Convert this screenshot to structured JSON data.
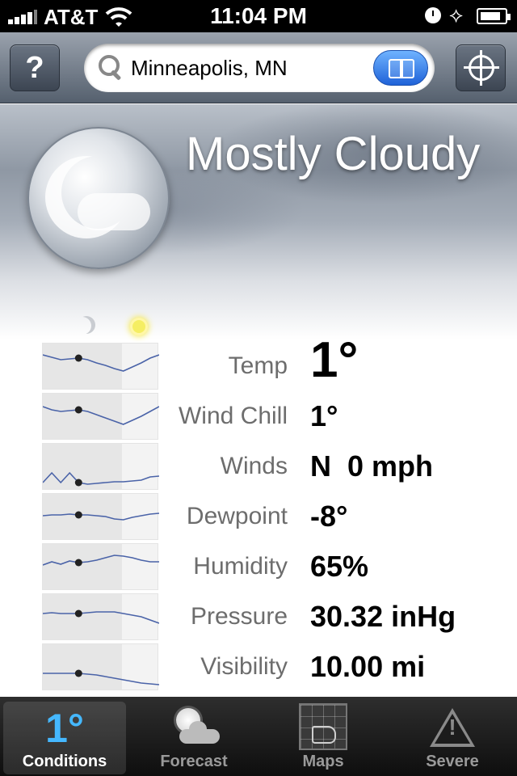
{
  "status_bar": {
    "carrier": "AT&T",
    "time": "11:04 PM",
    "bluetooth_glyph": "⟡"
  },
  "nav": {
    "help_label": "?",
    "search_value": "Minneapolis, MN",
    "icons": [
      "magnifier-icon",
      "bookmarks-icon",
      "crosshair-icon"
    ]
  },
  "hero": {
    "condition": "Mostly Cloudy",
    "icon": "mostly-cloudy-night-icon"
  },
  "conditions": [
    {
      "label": "Temp",
      "value": "1°",
      "trend": [
        14,
        17,
        20,
        19,
        18,
        20,
        24,
        27,
        31,
        34,
        29,
        24,
        18,
        14
      ]
    },
    {
      "label": "Wind Chill",
      "value": "1°",
      "trend": [
        16,
        20,
        22,
        21,
        20,
        22,
        26,
        30,
        34,
        38,
        33,
        28,
        22,
        16
      ]
    },
    {
      "label": "Winds",
      "value": "N  0 mph",
      "trend": [
        48,
        36,
        48,
        36,
        48,
        50,
        49,
        48,
        47,
        47,
        46,
        45,
        41,
        40
      ]
    },
    {
      "label": "Dewpoint",
      "value": "-8°",
      "trend": [
        27,
        26,
        26,
        25,
        26,
        26,
        27,
        28,
        31,
        32,
        29,
        27,
        25,
        24
      ]
    },
    {
      "label": "Humidity",
      "value": "65%",
      "trend": [
        26,
        22,
        25,
        21,
        23,
        22,
        20,
        17,
        14,
        15,
        17,
        20,
        22,
        22
      ]
    },
    {
      "label": "Pressure",
      "value": "30.32 inHg",
      "trend": [
        24,
        23,
        24,
        24,
        24,
        23,
        22,
        22,
        22,
        24,
        26,
        28,
        32,
        36
      ]
    },
    {
      "label": "Visibility",
      "value": "10.00 mi",
      "trend": [
        36,
        36,
        36,
        36,
        36,
        37,
        38,
        40,
        42,
        44,
        46,
        48,
        49,
        50
      ]
    }
  ],
  "tabs": [
    {
      "key": "conditions",
      "label": "Conditions",
      "icon_text": "1°",
      "active": true
    },
    {
      "key": "forecast",
      "label": "Forecast",
      "active": false
    },
    {
      "key": "maps",
      "label": "Maps",
      "active": false
    },
    {
      "key": "severe",
      "label": "Severe",
      "warn_mark": "!",
      "active": false
    }
  ],
  "colors": {
    "accent": "#45b8ff",
    "trend_line": "#4a63a8",
    "label": "#6d6d6d"
  }
}
